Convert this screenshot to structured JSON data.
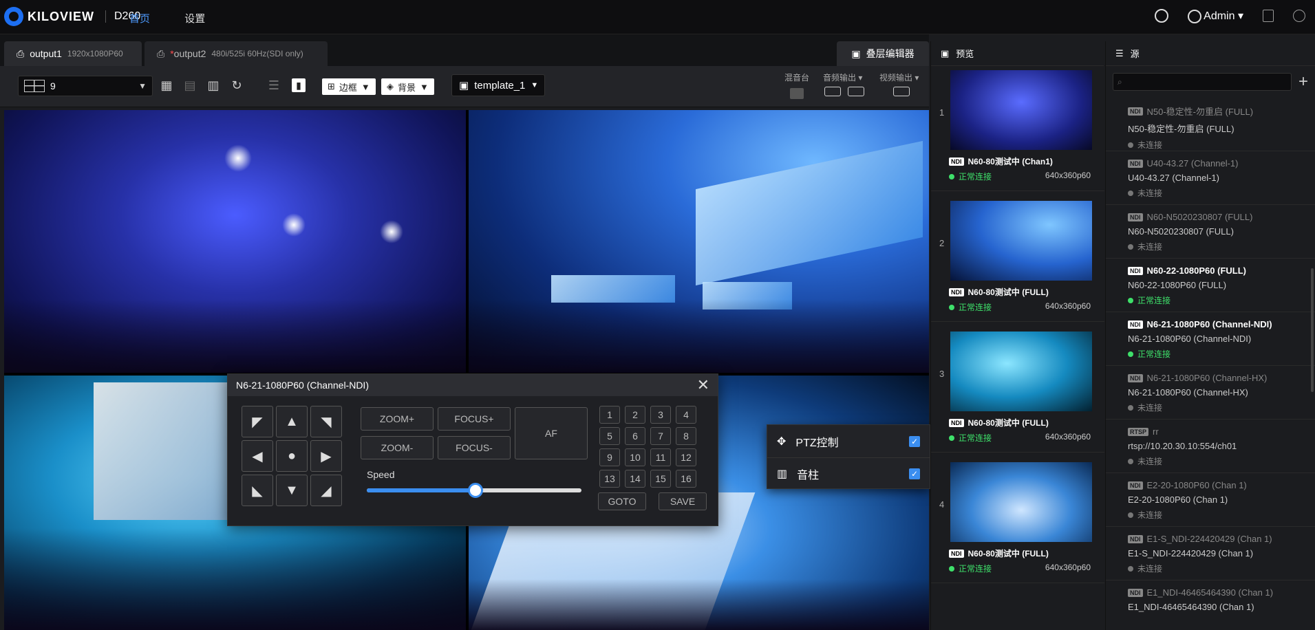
{
  "header": {
    "brand": "KILOVIEW",
    "model": "D260",
    "nav": [
      "首页",
      "设置"
    ],
    "user": "Admin"
  },
  "tabs": [
    {
      "name": "output1",
      "res": "1920x1080P60"
    },
    {
      "name": "output2",
      "res": "480i/525i 60Hz(SDI only)"
    }
  ],
  "layer_editor": "叠层编辑器",
  "toolbar": {
    "layout_value": "9",
    "border_label": "边框",
    "background_label": "背景",
    "template_value": "template_1",
    "mixer_label": "混音台",
    "audio_out_label": "音频输出",
    "video_out_label": "视频输出"
  },
  "ptz": {
    "title": "N6-21-1080P60 (Channel-NDI)",
    "zoom_in": "ZOOM+",
    "focus_in": "FOCUS+",
    "zoom_out": "ZOOM-",
    "focus_out": "FOCUS-",
    "af": "AF",
    "speed_label": "Speed",
    "speed_value": 0.505,
    "presets": [
      "1",
      "2",
      "3",
      "4",
      "5",
      "6",
      "7",
      "8",
      "9",
      "10",
      "11",
      "12",
      "13",
      "14",
      "15",
      "16"
    ],
    "goto": "GOTO",
    "save": "SAVE"
  },
  "context_menu": [
    {
      "label": "PTZ控制",
      "checked": true,
      "icon": "move-icon"
    },
    {
      "label": "音柱",
      "checked": true,
      "icon": "audio-bars-icon"
    }
  ],
  "preview": {
    "title": "预览",
    "items": [
      {
        "num": "1",
        "name": "N60-80测试中 (Chan1)",
        "status": "正常连接",
        "res": "640x360p60"
      },
      {
        "num": "2",
        "name": "N60-80测试中 (FULL)",
        "status": "正常连接",
        "res": "640x360p60"
      },
      {
        "num": "3",
        "name": "N60-80测试中 (FULL)",
        "status": "正常连接",
        "res": "640x360p60"
      },
      {
        "num": "4",
        "name": "N60-80测试中 (FULL)",
        "status": "正常连接",
        "res": "640x360p60"
      }
    ]
  },
  "sources": {
    "title": "源",
    "items": [
      {
        "tag": "NDI",
        "title": "N50-稳定性-勿重启 (FULL)",
        "sub": "N50-稳定性-勿重启 (FULL)",
        "status": "未连接",
        "on": false
      },
      {
        "tag": "NDI",
        "title": "U40-43.27 (Channel-1)",
        "sub": "U40-43.27 (Channel-1)",
        "status": "未连接",
        "on": false
      },
      {
        "tag": "NDI",
        "title": "N60-N5020230807 (FULL)",
        "sub": "N60-N5020230807 (FULL)",
        "status": "未连接",
        "on": false
      },
      {
        "tag": "NDI",
        "title": "N60-22-1080P60 (FULL)",
        "sub": "N60-22-1080P60 (FULL)",
        "status": "正常连接",
        "on": true
      },
      {
        "tag": "NDI",
        "title": "N6-21-1080P60 (Channel-NDI)",
        "sub": "N6-21-1080P60 (Channel-NDI)",
        "status": "正常连接",
        "on": true
      },
      {
        "tag": "NDI",
        "title": "N6-21-1080P60 (Channel-HX)",
        "sub": "N6-21-1080P60 (Channel-HX)",
        "status": "未连接",
        "on": false
      },
      {
        "tag": "RTSP",
        "title": "rr",
        "sub": "rtsp://10.20.30.10:554/ch01",
        "status": "未连接",
        "on": false
      },
      {
        "tag": "NDI",
        "title": "E2-20-1080P60 (Chan 1)",
        "sub": "E2-20-1080P60 (Chan 1)",
        "status": "未连接",
        "on": false
      },
      {
        "tag": "NDI",
        "title": "E1-S_NDI-224420429 (Chan 1)",
        "sub": "E1-S_NDI-224420429 (Chan 1)",
        "status": "未连接",
        "on": false
      },
      {
        "tag": "NDI",
        "title": "E1_NDI-46465464390 (Chan 1)",
        "sub": "E1_NDI-46465464390 (Chan 1)",
        "status": "",
        "on": false
      }
    ]
  },
  "colors": {
    "accent": "#3b8ef0",
    "ok": "#3ee06a",
    "nav_active": "#4d9bff"
  }
}
